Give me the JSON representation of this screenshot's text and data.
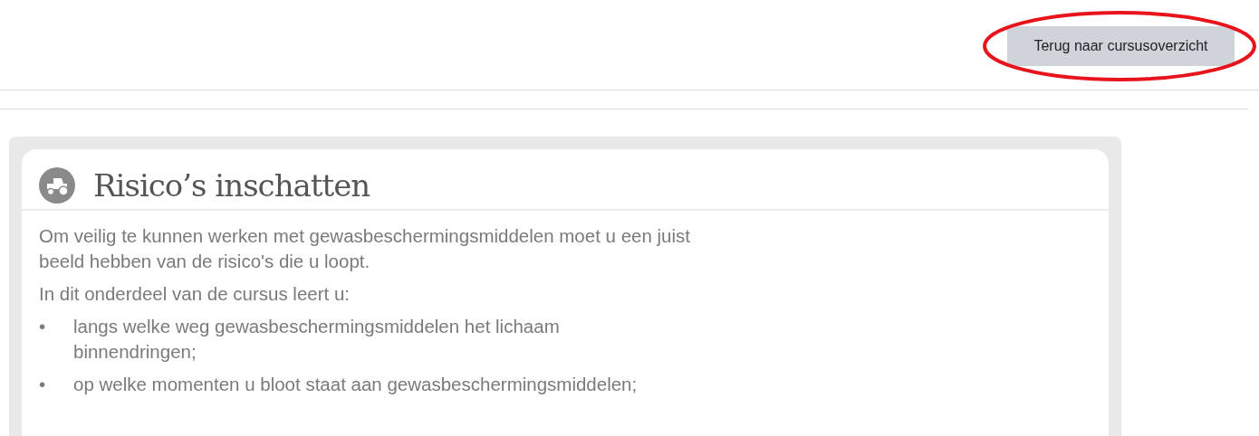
{
  "header": {
    "back_button": "Terug naar cursusoverzicht",
    "highlighted": true
  },
  "card": {
    "title": "Risico’s inschatten",
    "paragraphs": [
      "Om veilig te kunnen werken met gewasbeschermingsmiddelen moet u een juist beeld hebben van de risico's die u loopt.",
      "In dit onderdeel van de cursus leert u:"
    ],
    "list": [
      {
        "bullet": "•",
        "text": "langs welke weg gewasbeschermingsmiddelen het lichaam binnendringen;"
      },
      {
        "bullet": "•",
        "text": "op welke momenten u bloot staat aan gewasbeschermingsmiddelen;"
      }
    ]
  }
}
